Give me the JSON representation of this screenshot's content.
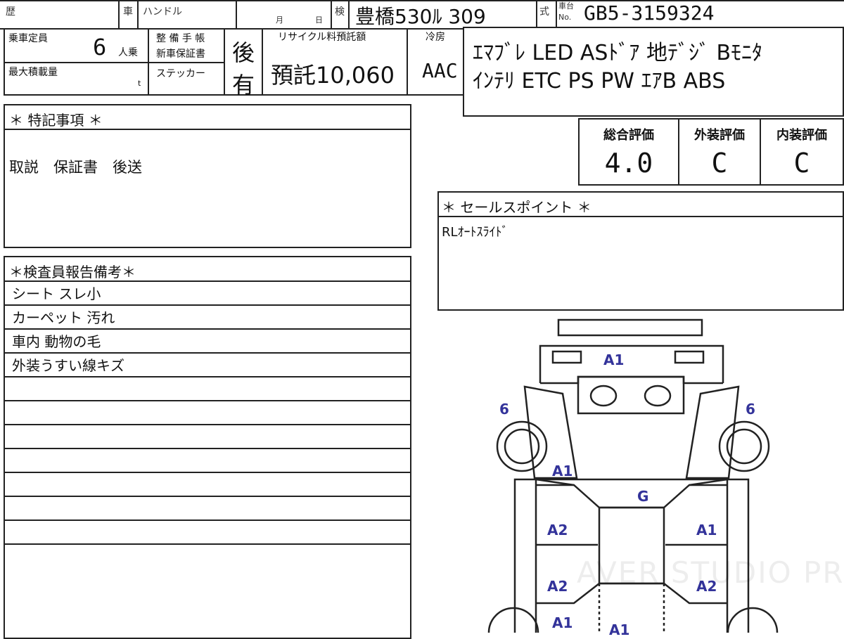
{
  "header": {
    "history_label": "歴",
    "vehicle_label": "車",
    "handle_label": "ハンドル",
    "month_label": "月",
    "day_label": "日",
    "inspection_label": "検",
    "plate": "豊橋530ﾙ 309",
    "model_label": "式",
    "chassis_label_top": "車台",
    "chassis_label_no": "No.",
    "chassis_number": "GB5-3159324"
  },
  "specs": {
    "capacity_label": "乗車定員",
    "capacity_value": "6",
    "capacity_unit": "人乗",
    "maintenance_label": "整 備 手 帳",
    "warranty_label": "新車保証書",
    "maintenance_value": "後",
    "max_load_label": "最大積載量",
    "max_load_unit": "t",
    "sticker_label": "ステッカー",
    "sticker_value": "有",
    "recycle_label": "リサイクル料預託額",
    "recycle_value": "預託10,060",
    "cooler_label": "冷房",
    "cooler_value": "AAC"
  },
  "equipment": {
    "line1": "ｴﾏﾌﾞﾚ LED ASﾄﾞｱ 地ﾃﾞｼﾞ Bﾓﾆﾀ",
    "line2": "ｲﾝﾃﾘ ETC PS PW ｴｱB ABS"
  },
  "special_notes": {
    "title": "＊ 特記事項 ＊",
    "text": "取説　保証書　後送"
  },
  "grades": {
    "overall_label": "総合評価",
    "overall_value": "4.0",
    "exterior_label": "外装評価",
    "exterior_value": "C",
    "interior_label": "内装評価",
    "interior_value": "C"
  },
  "sales_point": {
    "title": "＊ セールスポイント ＊",
    "text": "RLｵｰﾄｽﾗｲﾄﾞ"
  },
  "inspector_report": {
    "title": "＊検査員報告備考＊",
    "rows": [
      "シート スレ小",
      "カーペット 汚れ",
      "車内 動物の毛",
      "外装うすい線キズ",
      "",
      "",
      "",
      "",
      "",
      "",
      "",
      ""
    ]
  },
  "damage_marks": {
    "front": "A1",
    "tire_left": "6",
    "tire_right": "6",
    "front_left": "A1",
    "windshield": "G",
    "left_mid1": "A2",
    "right_mid1": "A1",
    "left_mid2": "A2",
    "right_mid2": "A2",
    "rear_left": "A1",
    "roof": "A1"
  },
  "watermark": "AVER STUDIO PRO",
  "colors": {
    "damage_mark": "#33339a",
    "border": "#222222"
  }
}
